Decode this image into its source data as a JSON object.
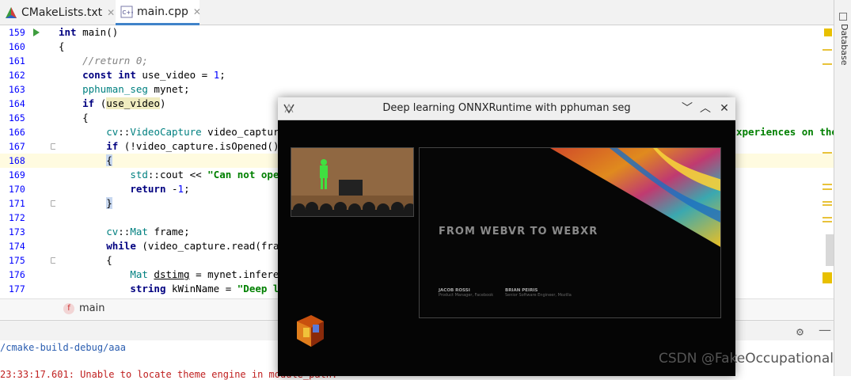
{
  "tabs": [
    {
      "label": "CMakeLists.txt",
      "icon": "cmake-icon",
      "active": false
    },
    {
      "label": "main.cpp",
      "icon": "cpp-file-icon",
      "active": true
    }
  ],
  "gutter": {
    "line_numbers": [
      "159",
      "160",
      "161",
      "162",
      "163",
      "164",
      "165",
      "166",
      "167",
      "168",
      "169",
      "170",
      "171",
      "172",
      "173",
      "174",
      "175",
      "176",
      "177"
    ]
  },
  "code": {
    "l159a": "int",
    "l159b": " main()",
    "l160": "{",
    "l161": "    //return 0;",
    "l162a": "    ",
    "l162b": "const",
    "l162c": " ",
    "l162d": "int",
    "l162e": " use_video = ",
    "l162f": "1",
    "l162g": ";",
    "l163a": "    ",
    "l163b": "pphuman_seg",
    "l163c": " mynet;",
    "l164a": "    ",
    "l164b": "if",
    "l164c": " (",
    "l164d": "use_video",
    "l164e": ")",
    "l165": "    {",
    "l166a": "        ",
    "l166b": "cv",
    "l166c": "::",
    "l166d": "VideoCapture",
    "l166e": " video_capture(",
    "l166_right": "xperiences on the",
    "l167a": "        ",
    "l167b": "if",
    "l167c": " (!video_capture.isOpened())",
    "l168a": "        ",
    "l168b": "{",
    "l169a": "            ",
    "l169b": "std",
    "l169c": "::cout << ",
    "l169d": "\"Can not open v",
    "l170a": "            ",
    "l170b": "return",
    "l170c": " -",
    "l170d": "1",
    "l170e": ";",
    "l171a": "        ",
    "l171b": "}",
    "l172": "",
    "l173a": "        ",
    "l173b": "cv",
    "l173c": "::",
    "l173d": "Mat",
    "l173e": " frame;",
    "l174a": "        ",
    "l174b": "while",
    "l174c": " (video_capture.read(frame)",
    "l175": "        {",
    "l176a": "            ",
    "l176b": "Mat",
    "l176c": " ",
    "l176d": "dstimg",
    "l176e": " = mynet.inference",
    "l177a": "            ",
    "l177b": "string",
    "l177c": " kWinName = ",
    "l177d": "\"Deep lear"
  },
  "side_fragments": {
    "aa1": "aa",
    "aa2": "aa"
  },
  "right_panel": {
    "label": "Database"
  },
  "breadcrumb": {
    "badge": "f",
    "label": "main"
  },
  "bottom": {
    "path": "/cmake-build-debug/aaa",
    "log": "23:33:17.601: Unable to locate theme engine in module_path: "
  },
  "window": {
    "title": "Deep learning ONNXRuntime with pphuman seg",
    "btn_min": "﹀",
    "btn_max": "︿",
    "btn_close": "✕",
    "slide_title": "FROM WEBVR TO WEBXR",
    "speaker1_name": "JACOB ROSSI",
    "speaker1_role": "Product Manager, Facebook",
    "speaker2_name": "BRIAN PEIRIS",
    "speaker2_role": "Senior Software Engineer, Mozilla"
  },
  "watermark": "CSDN @FakeOccupational",
  "colors": {
    "accent": "#4083c9",
    "keyword": "#000080",
    "string": "#008000",
    "type": "#008080"
  }
}
